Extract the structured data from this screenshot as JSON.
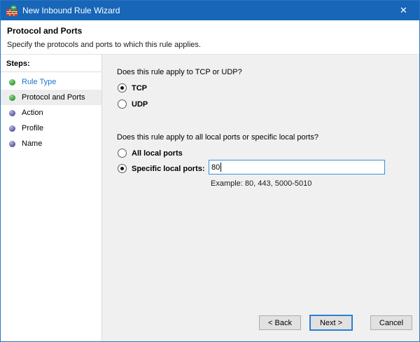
{
  "window": {
    "title": "New Inbound Rule Wizard",
    "close_glyph": "✕"
  },
  "header": {
    "title": "Protocol and Ports",
    "subtitle": "Specify the protocols and ports to which this rule applies."
  },
  "sidebar": {
    "heading": "Steps:",
    "steps": [
      {
        "label": "Rule Type",
        "state": "completed-link"
      },
      {
        "label": "Protocol and Ports",
        "state": "current"
      },
      {
        "label": "Action",
        "state": "upcoming"
      },
      {
        "label": "Profile",
        "state": "upcoming"
      },
      {
        "label": "Name",
        "state": "upcoming"
      }
    ]
  },
  "main": {
    "question1": "Does this rule apply to TCP or UDP?",
    "options1": [
      {
        "label": "TCP",
        "selected": true
      },
      {
        "label": "UDP",
        "selected": false
      }
    ],
    "question2": "Does this rule apply to all local ports or specific local ports?",
    "options2": [
      {
        "label": "All local ports",
        "selected": false
      },
      {
        "label": "Specific local ports:",
        "selected": true
      }
    ],
    "port_input": {
      "value": "80"
    },
    "example": "Example: 80, 443, 5000-5010"
  },
  "footer": {
    "back": "< Back",
    "next": "Next >",
    "cancel": "Cancel"
  },
  "colors": {
    "titlebar": "#1766b8",
    "window-border": "#2a75c0",
    "header-bg": "#ffffff",
    "body-bg": "#f0f0f0",
    "sidebar-bg": "#ffffff",
    "highlight": "#ededed",
    "step-done": "#3fa33f",
    "step-upcoming": "#6363aa",
    "link": "#1b75d1",
    "input-border": "#3a8fd6",
    "button-bg": "#e1e1e1",
    "button-border": "#adadad",
    "focus-border": "#2a7fd4"
  }
}
